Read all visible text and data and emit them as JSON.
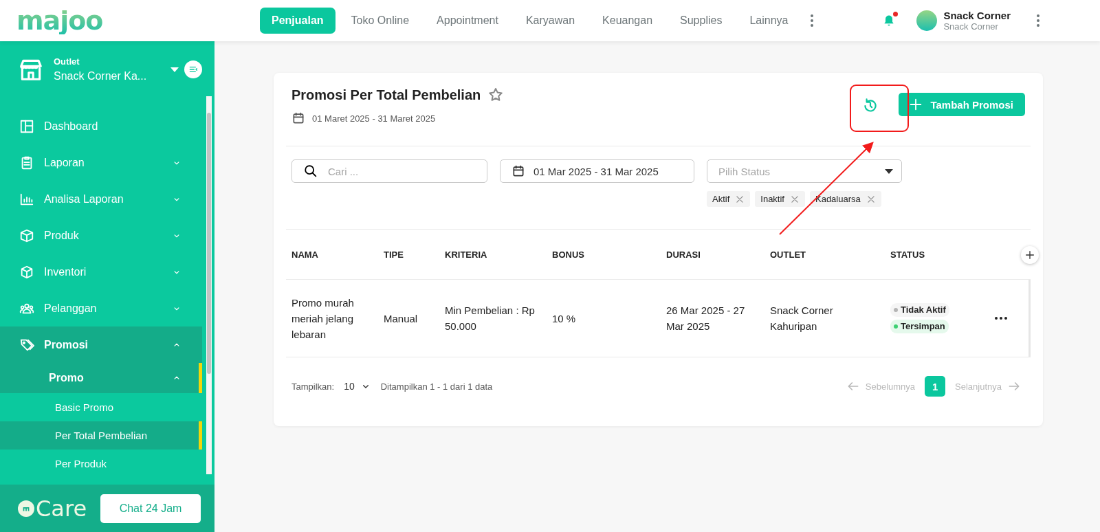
{
  "header": {
    "logo": "majoo",
    "nav": [
      {
        "label": "Penjualan",
        "selected": true
      },
      {
        "label": "Toko Online",
        "selected": false
      },
      {
        "label": "Appointment",
        "selected": false
      },
      {
        "label": "Karyawan",
        "selected": false
      },
      {
        "label": "Keuangan",
        "selected": false
      },
      {
        "label": "Supplies",
        "selected": false
      },
      {
        "label": "Lainnya",
        "selected": false
      }
    ],
    "notification_unread": true,
    "account": {
      "name": "Snack Corner",
      "subtitle": "Snack Corner"
    }
  },
  "sidebar": {
    "outlet_label": "Outlet",
    "outlet_name": "Snack Corner Ka...",
    "items": [
      {
        "label": "Dashboard",
        "kind": "link",
        "selected": false
      },
      {
        "label": "Laporan",
        "kind": "group",
        "expanded": false,
        "selected": false
      },
      {
        "label": "Analisa Laporan",
        "kind": "group",
        "expanded": false,
        "selected": false
      },
      {
        "label": "Produk",
        "kind": "group",
        "expanded": false,
        "selected": false
      },
      {
        "label": "Inventori",
        "kind": "group",
        "expanded": false,
        "selected": false
      },
      {
        "label": "Pelanggan",
        "kind": "group",
        "expanded": false,
        "selected": false
      },
      {
        "label": "Promosi",
        "kind": "group",
        "expanded": true,
        "selected": true,
        "children": [
          {
            "label": "Promo",
            "kind": "group",
            "expanded": true,
            "selected": true,
            "children": [
              {
                "label": "Basic Promo",
                "kind": "link",
                "selected": false
              },
              {
                "label": "Per Total Pembelian",
                "kind": "link",
                "selected": true
              },
              {
                "label": "Per Produk",
                "kind": "link",
                "selected": false
              }
            ]
          }
        ]
      }
    ],
    "footer": {
      "brand": "Care",
      "button": "Chat 24 Jam"
    }
  },
  "page": {
    "title": "Promosi Per Total Pembelian",
    "favorite": false,
    "period": "01 Maret 2025 - 31 Maret 2025",
    "add_button": "Tambah Promosi",
    "search": {
      "placeholder": "Cari ..."
    },
    "date_range": "01 Mar 2025 - 31 Mar 2025",
    "status_select": {
      "placeholder": "Pilih Status"
    },
    "status_filters": [
      "Aktif",
      "Inaktif",
      "Kadaluarsa"
    ]
  },
  "table": {
    "columns": [
      "NAMA",
      "TIPE",
      "KRITERIA",
      "BONUS",
      "DURASI",
      "OUTLET",
      "STATUS"
    ],
    "rows": [
      {
        "cells": [
          "Promo murah meriah jelang lebaran",
          "Manual",
          "Min Pembelian : Rp 50.000",
          "10 %",
          "26 Mar 2025 - 27 Mar 2025",
          "Snack Corner Kahuripan"
        ],
        "statuses": [
          {
            "label": "Tidak Aktif",
            "color": "#b5b5b5"
          },
          {
            "label": "Tersimpan",
            "color": "#3dd072"
          }
        ]
      }
    ]
  },
  "pagination": {
    "page_size_label": "Tampilkan:",
    "page_size": "10",
    "summary": "Ditampilkan 1 - 1 dari 1 data",
    "prev": {
      "label": "Sebelumnya",
      "disabled": true
    },
    "pages": [
      {
        "label": "1",
        "selected": true
      }
    ],
    "next": {
      "label": "Selanjutnya",
      "disabled": true
    }
  }
}
